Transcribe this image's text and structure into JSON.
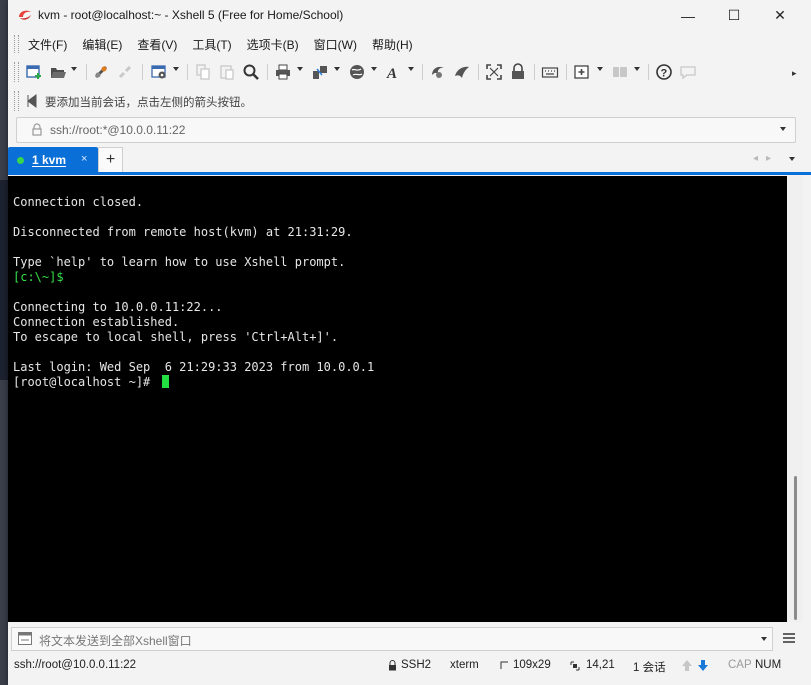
{
  "window": {
    "title": "kvm - root@localhost:~ - Xshell 5 (Free for Home/School)"
  },
  "window_controls": {
    "minimize": "—",
    "maximize": "☐",
    "close": "✕"
  },
  "menu": [
    "文件(F)",
    "编辑(E)",
    "查看(V)",
    "工具(T)",
    "选项卡(B)",
    "窗口(W)",
    "帮助(H)"
  ],
  "toolbar_icons": [
    "new-session-icon",
    "open-folder-icon",
    "connect-icon",
    "disconnect-icon",
    "properties-icon",
    "copy-icon",
    "paste-icon",
    "find-icon",
    "print-icon",
    "transfer-icon",
    "globe-icon",
    "font-icon",
    "xftp-icon",
    "xmanager-icon",
    "fullscreen-icon",
    "lock-icon",
    "keyboard-icon",
    "add-tab-icon",
    "layout-icon",
    "help-icon",
    "chat-icon"
  ],
  "hint": {
    "text": "要添加当前会话，点击左侧的箭头按钮。"
  },
  "address": {
    "value": "ssh://root:*@10.0.0.11:22"
  },
  "tabs": [
    {
      "label": "1 kvm",
      "status_color": "#37d64e",
      "close": "×"
    }
  ],
  "tab_add": "+",
  "tab_nav": {
    "left": "◂",
    "right": "▸"
  },
  "terminal": {
    "lines": [
      {
        "text": "Connection closed.",
        "style": "normal"
      },
      {
        "text": "",
        "style": "normal"
      },
      {
        "text": "Disconnected from remote host(kvm) at 21:31:29.",
        "style": "normal"
      },
      {
        "text": "",
        "style": "normal"
      },
      {
        "text": "Type `help' to learn how to use Xshell prompt.",
        "style": "normal"
      },
      {
        "text": "[c:\\~]$",
        "style": "green"
      },
      {
        "text": "",
        "style": "normal"
      },
      {
        "text": "Connecting to 10.0.0.11:22...",
        "style": "normal"
      },
      {
        "text": "Connection established.",
        "style": "normal"
      },
      {
        "text": "To escape to local shell, press 'Ctrl+Alt+]'.",
        "style": "normal"
      },
      {
        "text": "",
        "style": "normal"
      },
      {
        "text": "Last login: Wed Sep  6 21:29:33 2023 from 10.0.0.1",
        "style": "normal"
      },
      {
        "text": "[root@localhost ~]# ",
        "style": "normal",
        "cursor": true
      }
    ],
    "cursor_color": "#22e042"
  },
  "compose": {
    "placeholder": "将文本发送到全部Xshell窗口"
  },
  "status": {
    "connection": "ssh://root@10.0.0.11:22",
    "protocol": "SSH2",
    "terminal_type": "xterm",
    "size": "109x29",
    "cursor_pos": "14,21",
    "sessions": "1 会话",
    "caps": "CAP",
    "num": "NUM"
  },
  "colors": {
    "accent": "#0b6fd8",
    "terminal_bg": "#000000",
    "prompt_green": "#34e04a"
  }
}
